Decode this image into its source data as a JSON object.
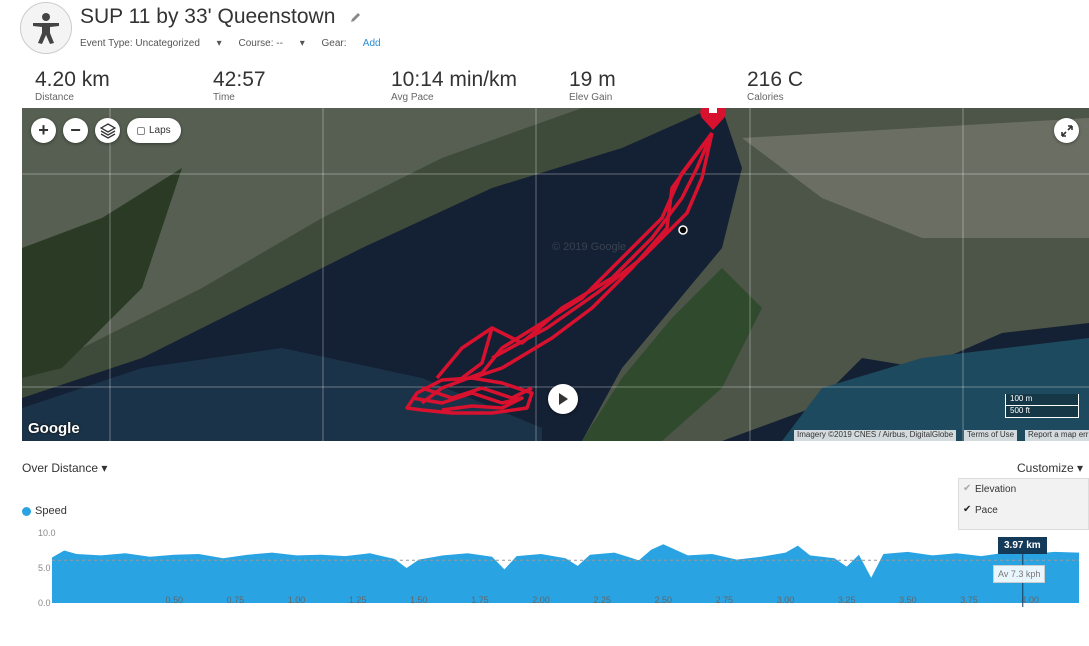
{
  "activity": {
    "title": "SUP 11 by 33' Queenstown",
    "event_type": "Event Type: Uncategorized",
    "course": "Course: --",
    "gear_label": "Gear:",
    "gear_add": "Add"
  },
  "stats": [
    {
      "value": "4.20 km",
      "label": "Distance"
    },
    {
      "value": "42:57",
      "label": "Time"
    },
    {
      "value": "10:14 min/km",
      "label": "Avg Pace"
    },
    {
      "value": "19 m",
      "label": "Elev Gain"
    },
    {
      "value": "216 C",
      "label": "Calories"
    }
  ],
  "map": {
    "zoom_in": "+",
    "zoom_out": "−",
    "laps_label": "Laps",
    "google": "Google",
    "watermark": "© 2019 Google",
    "imagery": "Imagery ©2019 CNES / Airbus, DigitalGlobe",
    "terms": "Terms of Use",
    "report": "Report a map err",
    "scale_m": "100 m",
    "scale_ft": "500 ft",
    "route_color": "#d8112f"
  },
  "chart_controls": {
    "over_distance": "Over Distance",
    "customize": "Customize",
    "options": [
      {
        "label": "Elevation",
        "checked": false
      },
      {
        "label": "Pace",
        "checked": true
      }
    ]
  },
  "chart_data": {
    "type": "area",
    "series": [
      {
        "name": "Speed",
        "color": "#2aa3e3"
      }
    ],
    "y_ticks": [
      "10.0",
      "5.0",
      "0.0"
    ],
    "ylim": [
      0,
      10
    ],
    "xlim": [
      0,
      4.2
    ],
    "x_ticks": [
      "0.50",
      "0.75",
      "1.00",
      "1.25",
      "1.50",
      "1.75",
      "2.00",
      "2.25",
      "2.50",
      "2.75",
      "3.00",
      "3.25",
      "3.50",
      "3.75",
      "4.00"
    ],
    "avg": 6.1,
    "x": [
      0,
      0.05,
      0.1,
      0.2,
      0.3,
      0.4,
      0.5,
      0.6,
      0.7,
      0.8,
      0.9,
      1.0,
      1.1,
      1.2,
      1.3,
      1.4,
      1.45,
      1.5,
      1.6,
      1.7,
      1.8,
      1.85,
      1.9,
      2.0,
      2.1,
      2.15,
      2.2,
      2.3,
      2.4,
      2.45,
      2.5,
      2.6,
      2.7,
      2.8,
      2.9,
      3.0,
      3.05,
      3.1,
      3.2,
      3.25,
      3.3,
      3.35,
      3.4,
      3.5,
      3.6,
      3.7,
      3.8,
      3.9,
      4.0,
      4.1,
      4.2
    ],
    "values": [
      6.5,
      7.5,
      7.0,
      6.8,
      7.1,
      6.6,
      6.9,
      7.0,
      6.4,
      6.9,
      7.2,
      6.8,
      6.9,
      6.7,
      7.1,
      6.3,
      5.0,
      6.2,
      6.8,
      7.1,
      6.6,
      4.8,
      6.7,
      7.0,
      6.4,
      5.3,
      6.9,
      7.2,
      6.1,
      7.6,
      8.4,
      6.8,
      7.0,
      6.2,
      6.6,
      7.2,
      8.2,
      6.8,
      6.4,
      5.2,
      6.9,
      3.6,
      7.0,
      7.3,
      6.8,
      7.1,
      6.7,
      7.2,
      7.0,
      7.3,
      7.2
    ],
    "cursor": {
      "x_label": "3.97 km",
      "value_label": "7.3 kph",
      "avg_label": "Av"
    }
  }
}
